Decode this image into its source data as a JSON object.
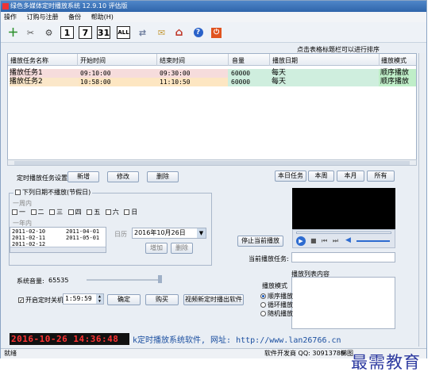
{
  "window": {
    "title": "绿色多媒体定时播放系统 12.9.10 评估版"
  },
  "menu": [
    "操作",
    "订购与注册",
    "备份",
    "帮助(H)"
  ],
  "toolbar": {
    "icons": [
      "add-icon",
      "scissors-icon",
      "settings-icon",
      "calendar-1-icon",
      "calendar-7-icon",
      "calendar-31-icon",
      "calendar-all-icon",
      "sync-icon",
      "envelope-icon",
      "home-icon",
      "help-icon",
      "power-icon"
    ],
    "labels": {
      "d1": "1",
      "d7": "7",
      "d31": "31",
      "all": "ALL"
    }
  },
  "hint": "点击表格标题栏可以进行排序",
  "grid": {
    "columns": [
      "播放任务名称",
      "开始时间",
      "结束时间",
      "音量",
      "播放日期",
      "播放模式"
    ],
    "rows": [
      [
        "播放任务1",
        "09:10:00",
        "09:30:00",
        "60000",
        "每天",
        "顺序播放"
      ],
      [
        "播放任务2",
        "10:58:00",
        "11:10:50",
        "60000",
        "每天",
        "顺序播放"
      ]
    ]
  },
  "task_settings": {
    "label": "定时播放任务设置:",
    "add": "新增",
    "edit": "修改",
    "delete": "删除"
  },
  "filters": {
    "today": "本日任务",
    "week": "本周",
    "month": "本月",
    "all": "所有"
  },
  "holiday": {
    "label": "下列日期不播放(节假日)",
    "weekly_label": "一周内",
    "weekdays": [
      "一",
      "二",
      "三",
      "四",
      "五",
      "六",
      "日"
    ],
    "year_label": "一年内",
    "dates_col1": [
      "2011-02-10",
      "2011-02-11",
      "2011-02-12"
    ],
    "dates_col2": [
      "2011-04-01",
      "2011-05-01"
    ],
    "date_label": "日历",
    "date_value": "2016年10月26日",
    "add": "增加",
    "delete": "删除"
  },
  "player": {
    "stop": "停止当前播放",
    "current_task_label": "当前播放任务:",
    "playlist_label": "播放列表内容"
  },
  "volume": {
    "label": "系统音量:",
    "value": "65535"
  },
  "shutdown": {
    "label": "开启定时关机",
    "time": "1:59:59",
    "ok": "确定",
    "buy": "购买",
    "add_to_list": "视频新定时播出软件"
  },
  "play_mode": {
    "label": "播放模式",
    "options": [
      "顺序播放",
      "循环播放",
      "随机播放"
    ]
  },
  "clock": "2016-10-26  14:36:48",
  "website": "k定时播放系统软件, 网址: http://www.lan26766.cn",
  "status": {
    "ready": "就绪",
    "dev": "软件开发商 QQ: 30913789",
    "extra": "梯图"
  },
  "watermark": "最需教育",
  "colors": {
    "row1": "#f6dcdc",
    "row2": "#fbe7c9",
    "rowtime2": "#fde6c2",
    "mode": "#bfeec8",
    "date": "#cfeede"
  }
}
